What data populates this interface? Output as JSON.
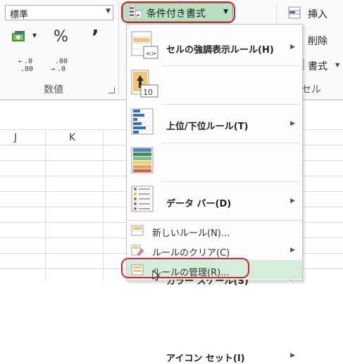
{
  "ribbon": {
    "number_format": "標準",
    "percent": "%",
    "comma": "’",
    "inc_decimal": [
      ".0",
      ".00"
    ],
    "inc_decimal_prefix": "←",
    "dec_decimal": [
      ".00",
      ".0"
    ],
    "dec_decimal_prefix": "→",
    "group_number": "数値",
    "conditional_formatting": "条件付き書式",
    "insert": "挿入",
    "delete": "削除",
    "format": "書式",
    "group_cells_partial": "セル"
  },
  "columns": [
    "J",
    "K"
  ],
  "menu": {
    "items": [
      {
        "label": "セルの強調表示ルール(H)",
        "icon": "highlight-cells-rules-icon",
        "submenu": true
      },
      {
        "label": "上位/下位ルール(T)",
        "icon": "top-bottom-rules-icon",
        "submenu": true
      },
      {
        "label": "データ バー(D)",
        "icon": "data-bars-icon",
        "submenu": true
      },
      {
        "label": "カラー スケール(S)",
        "icon": "color-scales-icon",
        "submenu": true
      },
      {
        "label": "アイコン セット(I)",
        "icon": "icon-sets-icon",
        "submenu": true
      }
    ],
    "small_items": [
      {
        "label": "新しいルール(N)...",
        "icon": "new-rule-icon",
        "submenu": false
      },
      {
        "label": "ルールのクリア(C)",
        "icon": "clear-rules-icon",
        "submenu": true
      },
      {
        "label": "ルールの管理(R)...",
        "icon": "manage-rules-icon",
        "submenu": false,
        "highlighted": true
      }
    ],
    "highlight_cells_glyph": "<>",
    "top_bottom_glyph": "10"
  },
  "colors": {
    "accent_green": "#b8dfc0",
    "highlight_red": "#e0202a",
    "hover": "#d5eedb"
  }
}
